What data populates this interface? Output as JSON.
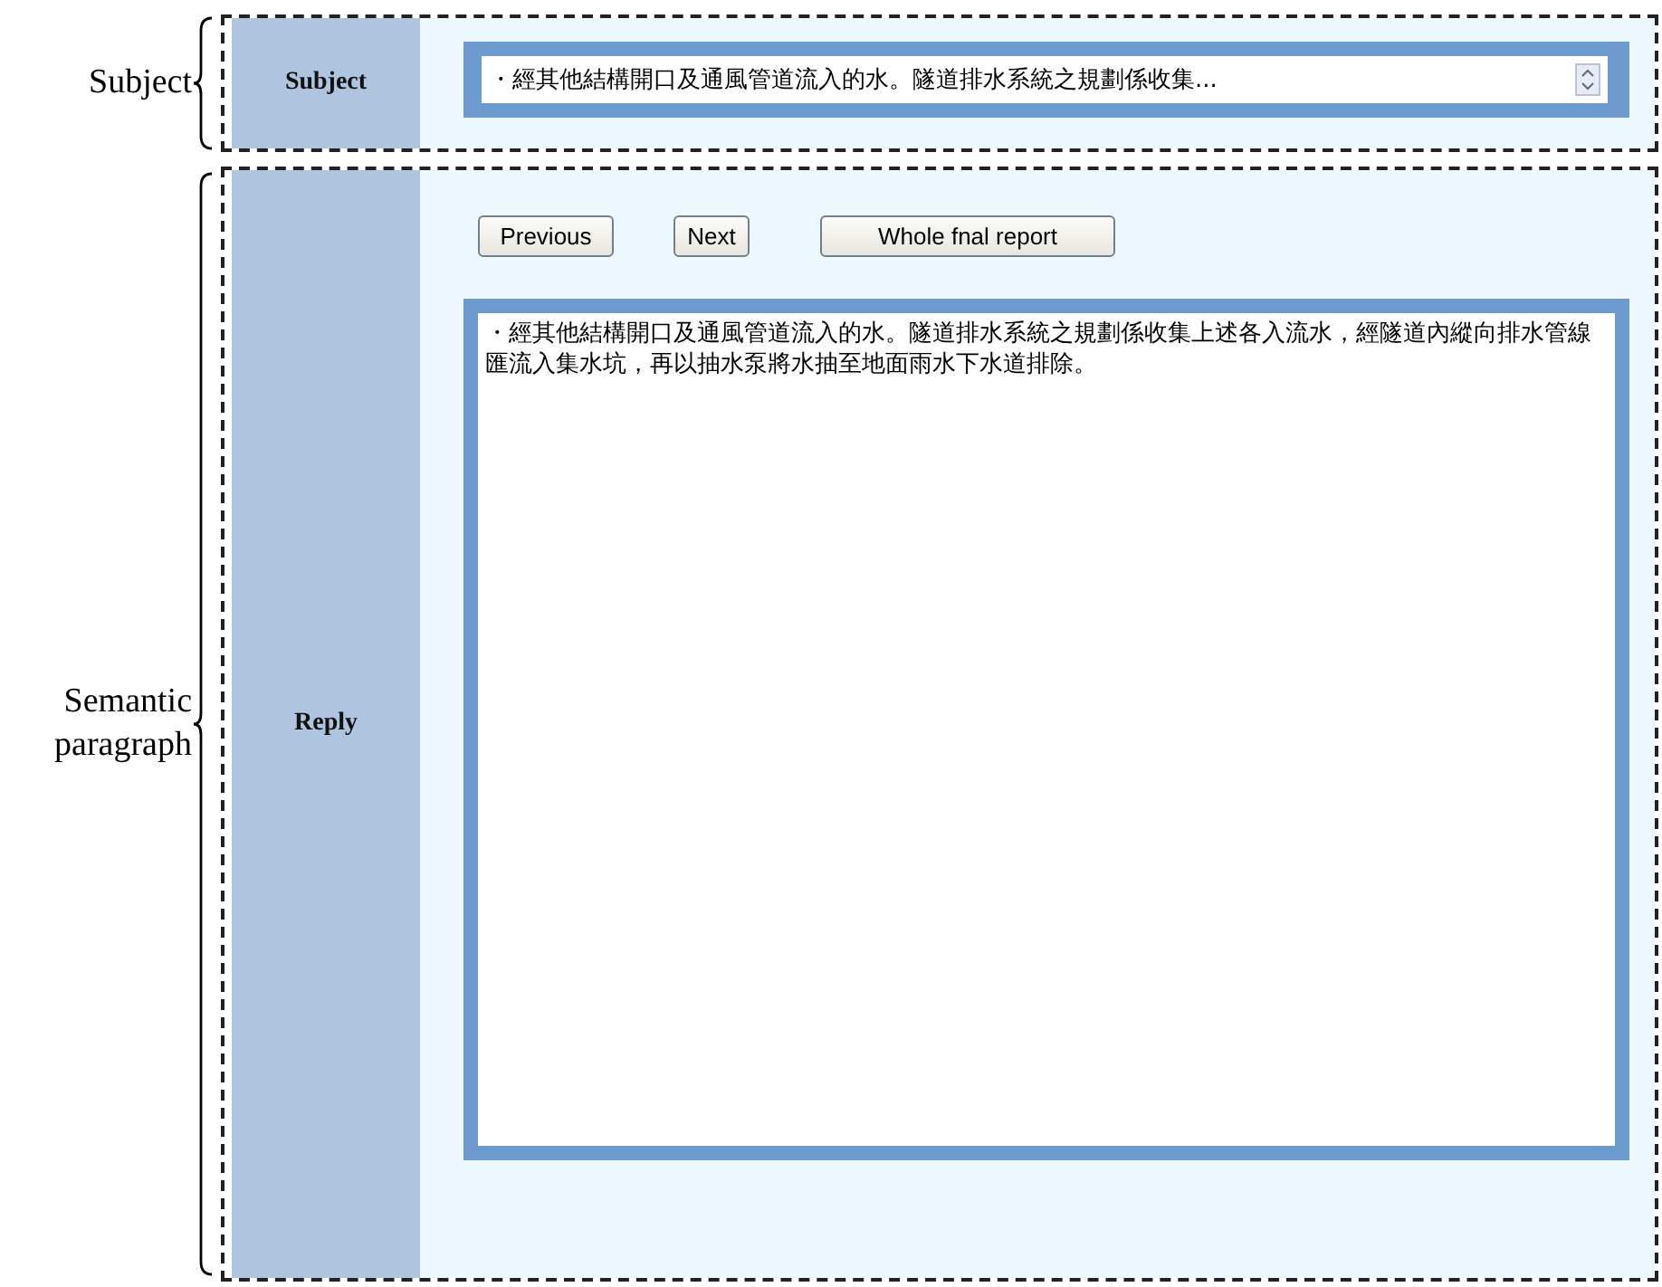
{
  "subject": {
    "annotation": "Subject",
    "label": "Subject",
    "value": "・經其他結構開口及通風管道流入的水。隧道排水系統之規劃係收集..."
  },
  "reply": {
    "annotation": "Semantic paragraph",
    "label": "Reply",
    "buttons": [
      "Previous",
      "Next",
      "Whole fnal report"
    ],
    "text": "・經其他結構開口及通風管道流入的水。隧道排水系統之規劃係收集上述各入流水，經隧道內縱向排水管線匯流入集水坑，再以抽水泵將水抽至地面雨水下水道排除。"
  }
}
